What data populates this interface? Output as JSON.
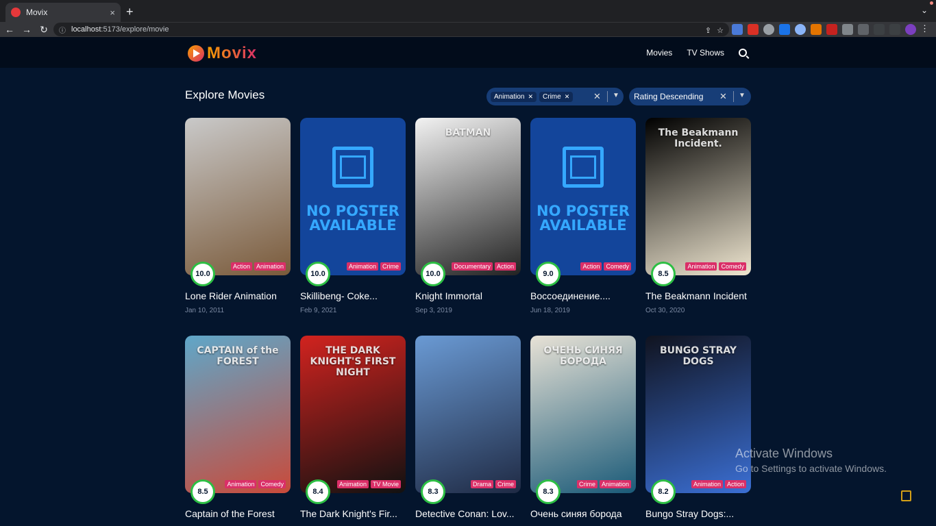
{
  "browser": {
    "tab_title": "Movix",
    "tab_close": "×",
    "new_tab": "+",
    "url_host": "localhost",
    "url_path": ":5173/explore/movie"
  },
  "app": {
    "logo_text": "Movix",
    "nav": [
      "Movies",
      "TV Shows"
    ]
  },
  "page": {
    "title": "Explore Movies",
    "genre_filter": {
      "chips": [
        "Animation",
        "Crime"
      ]
    },
    "sort_filter": {
      "value": "Rating Descending"
    }
  },
  "movies": [
    {
      "title": "Lone Rider Animation",
      "date": "Jan 10, 2011",
      "rating": "10.0",
      "genres": [
        "Action",
        "Animation"
      ],
      "poster": "art",
      "colors": [
        "#c9c9c9",
        "#7a5a3a"
      ]
    },
    {
      "title": "Skillibeng- Coke...",
      "date": "Feb 9, 2021",
      "rating": "10.0",
      "genres": [
        "Animation",
        "Crime"
      ],
      "poster": "none",
      "no_poster_text": "NO POSTER AVAILABLE"
    },
    {
      "title": "Knight Immortal",
      "date": "Sep 3, 2019",
      "rating": "10.0",
      "genres": [
        "Documentary",
        "Action"
      ],
      "poster": "art",
      "poster_text": "BATMAN",
      "colors": [
        "#f2f2f2",
        "#222222"
      ]
    },
    {
      "title": "Воссоединение....",
      "date": "Jun 18, 2019",
      "rating": "9.0",
      "genres": [
        "Action",
        "Comedy"
      ],
      "poster": "none",
      "no_poster_text": "NO POSTER AVAILABLE"
    },
    {
      "title": "The Beakmann Incident",
      "date": "Oct 30, 2020",
      "rating": "8.5",
      "genres": [
        "Animation",
        "Comedy"
      ],
      "poster": "art",
      "poster_text": "The Beakmann Incident.",
      "colors": [
        "#000000",
        "#efe6d0"
      ]
    },
    {
      "title": "Captain of the Forest",
      "date": "",
      "rating": "8.5",
      "genres": [
        "Animation",
        "Comedy"
      ],
      "poster": "art",
      "poster_text": "CAPTAIN of the FOREST",
      "colors": [
        "#5fa7c9",
        "#c94a3a"
      ]
    },
    {
      "title": "The Dark Knight's Fir...",
      "date": "",
      "rating": "8.4",
      "genres": [
        "Animation",
        "TV Movie"
      ],
      "poster": "art",
      "poster_text": "THE DARK KNIGHT'S FIRST NIGHT",
      "colors": [
        "#d2231f",
        "#111111"
      ]
    },
    {
      "title": "Detective Conan: Lov...",
      "date": "",
      "rating": "8.3",
      "genres": [
        "Drama",
        "Crime"
      ],
      "poster": "art",
      "colors": [
        "#6a9ad4",
        "#1f2a44"
      ]
    },
    {
      "title": "Очень синяя борода",
      "date": "",
      "rating": "8.3",
      "genres": [
        "Crime",
        "Animation"
      ],
      "poster": "art",
      "poster_text": "ОЧЕНЬ СИНЯЯ БОРОДА",
      "colors": [
        "#e8e2d6",
        "#1a5a78"
      ]
    },
    {
      "title": "Bungo Stray Dogs:...",
      "date": "",
      "rating": "8.2",
      "genres": [
        "Animation",
        "Action"
      ],
      "poster": "art",
      "poster_text": "BUNGO STRAY DOGS",
      "colors": [
        "#10131f",
        "#3b6fd4"
      ]
    }
  ],
  "watermark": {
    "line1": "Activate Windows",
    "line2": "Go to Settings to activate Windows."
  }
}
